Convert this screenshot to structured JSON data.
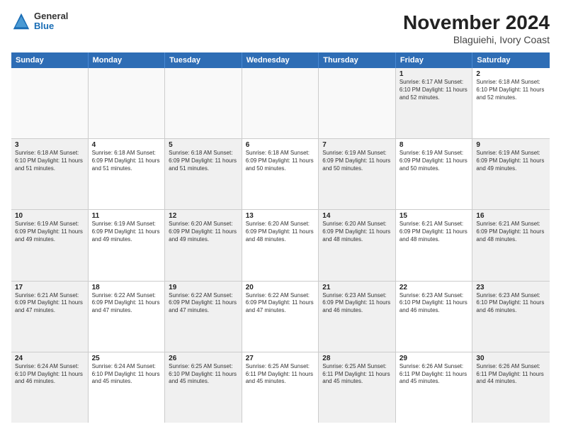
{
  "logo": {
    "general": "General",
    "blue": "Blue"
  },
  "title": "November 2024",
  "subtitle": "Blaguiehi, Ivory Coast",
  "days_of_week": [
    "Sunday",
    "Monday",
    "Tuesday",
    "Wednesday",
    "Thursday",
    "Friday",
    "Saturday"
  ],
  "weeks": [
    [
      {
        "day": "",
        "info": "",
        "empty": true
      },
      {
        "day": "",
        "info": "",
        "empty": true
      },
      {
        "day": "",
        "info": "",
        "empty": true
      },
      {
        "day": "",
        "info": "",
        "empty": true
      },
      {
        "day": "",
        "info": "",
        "empty": true
      },
      {
        "day": "1",
        "info": "Sunrise: 6:17 AM\nSunset: 6:10 PM\nDaylight: 11 hours and 52 minutes.",
        "shaded": true
      },
      {
        "day": "2",
        "info": "Sunrise: 6:18 AM\nSunset: 6:10 PM\nDaylight: 11 hours and 52 minutes.",
        "shaded": false
      }
    ],
    [
      {
        "day": "3",
        "info": "Sunrise: 6:18 AM\nSunset: 6:10 PM\nDaylight: 11 hours and 51 minutes.",
        "shaded": true
      },
      {
        "day": "4",
        "info": "Sunrise: 6:18 AM\nSunset: 6:09 PM\nDaylight: 11 hours and 51 minutes.",
        "shaded": false
      },
      {
        "day": "5",
        "info": "Sunrise: 6:18 AM\nSunset: 6:09 PM\nDaylight: 11 hours and 51 minutes.",
        "shaded": true
      },
      {
        "day": "6",
        "info": "Sunrise: 6:18 AM\nSunset: 6:09 PM\nDaylight: 11 hours and 50 minutes.",
        "shaded": false
      },
      {
        "day": "7",
        "info": "Sunrise: 6:19 AM\nSunset: 6:09 PM\nDaylight: 11 hours and 50 minutes.",
        "shaded": true
      },
      {
        "day": "8",
        "info": "Sunrise: 6:19 AM\nSunset: 6:09 PM\nDaylight: 11 hours and 50 minutes.",
        "shaded": false
      },
      {
        "day": "9",
        "info": "Sunrise: 6:19 AM\nSunset: 6:09 PM\nDaylight: 11 hours and 49 minutes.",
        "shaded": true
      }
    ],
    [
      {
        "day": "10",
        "info": "Sunrise: 6:19 AM\nSunset: 6:09 PM\nDaylight: 11 hours and 49 minutes.",
        "shaded": true
      },
      {
        "day": "11",
        "info": "Sunrise: 6:19 AM\nSunset: 6:09 PM\nDaylight: 11 hours and 49 minutes.",
        "shaded": false
      },
      {
        "day": "12",
        "info": "Sunrise: 6:20 AM\nSunset: 6:09 PM\nDaylight: 11 hours and 49 minutes.",
        "shaded": true
      },
      {
        "day": "13",
        "info": "Sunrise: 6:20 AM\nSunset: 6:09 PM\nDaylight: 11 hours and 48 minutes.",
        "shaded": false
      },
      {
        "day": "14",
        "info": "Sunrise: 6:20 AM\nSunset: 6:09 PM\nDaylight: 11 hours and 48 minutes.",
        "shaded": true
      },
      {
        "day": "15",
        "info": "Sunrise: 6:21 AM\nSunset: 6:09 PM\nDaylight: 11 hours and 48 minutes.",
        "shaded": false
      },
      {
        "day": "16",
        "info": "Sunrise: 6:21 AM\nSunset: 6:09 PM\nDaylight: 11 hours and 48 minutes.",
        "shaded": true
      }
    ],
    [
      {
        "day": "17",
        "info": "Sunrise: 6:21 AM\nSunset: 6:09 PM\nDaylight: 11 hours and 47 minutes.",
        "shaded": true
      },
      {
        "day": "18",
        "info": "Sunrise: 6:22 AM\nSunset: 6:09 PM\nDaylight: 11 hours and 47 minutes.",
        "shaded": false
      },
      {
        "day": "19",
        "info": "Sunrise: 6:22 AM\nSunset: 6:09 PM\nDaylight: 11 hours and 47 minutes.",
        "shaded": true
      },
      {
        "day": "20",
        "info": "Sunrise: 6:22 AM\nSunset: 6:09 PM\nDaylight: 11 hours and 47 minutes.",
        "shaded": false
      },
      {
        "day": "21",
        "info": "Sunrise: 6:23 AM\nSunset: 6:09 PM\nDaylight: 11 hours and 46 minutes.",
        "shaded": true
      },
      {
        "day": "22",
        "info": "Sunrise: 6:23 AM\nSunset: 6:10 PM\nDaylight: 11 hours and 46 minutes.",
        "shaded": false
      },
      {
        "day": "23",
        "info": "Sunrise: 6:23 AM\nSunset: 6:10 PM\nDaylight: 11 hours and 46 minutes.",
        "shaded": true
      }
    ],
    [
      {
        "day": "24",
        "info": "Sunrise: 6:24 AM\nSunset: 6:10 PM\nDaylight: 11 hours and 46 minutes.",
        "shaded": true
      },
      {
        "day": "25",
        "info": "Sunrise: 6:24 AM\nSunset: 6:10 PM\nDaylight: 11 hours and 45 minutes.",
        "shaded": false
      },
      {
        "day": "26",
        "info": "Sunrise: 6:25 AM\nSunset: 6:10 PM\nDaylight: 11 hours and 45 minutes.",
        "shaded": true
      },
      {
        "day": "27",
        "info": "Sunrise: 6:25 AM\nSunset: 6:11 PM\nDaylight: 11 hours and 45 minutes.",
        "shaded": false
      },
      {
        "day": "28",
        "info": "Sunrise: 6:25 AM\nSunset: 6:11 PM\nDaylight: 11 hours and 45 minutes.",
        "shaded": true
      },
      {
        "day": "29",
        "info": "Sunrise: 6:26 AM\nSunset: 6:11 PM\nDaylight: 11 hours and 45 minutes.",
        "shaded": false
      },
      {
        "day": "30",
        "info": "Sunrise: 6:26 AM\nSunset: 6:11 PM\nDaylight: 11 hours and 44 minutes.",
        "shaded": true
      }
    ]
  ]
}
